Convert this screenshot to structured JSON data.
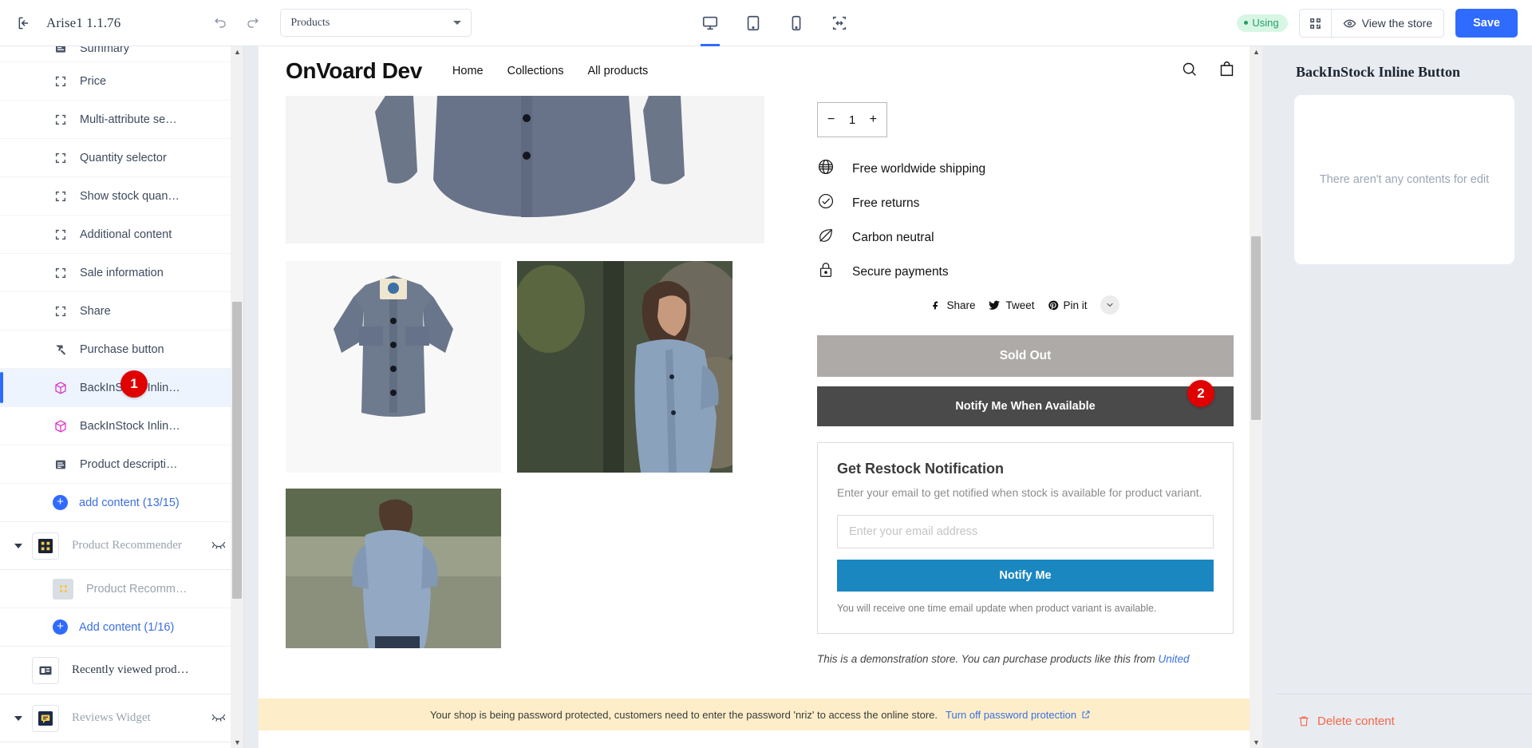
{
  "topbar": {
    "back_icon": "exit-icon",
    "title": "Arise1 1.1.76",
    "undo_icon": "undo-icon",
    "redo_icon": "redo-icon",
    "page_select": {
      "value": "Products",
      "caret_icon": "chevron-down-icon"
    },
    "devices": [
      {
        "name": "desktop",
        "icon": "desktop-icon",
        "active": true
      },
      {
        "name": "tablet",
        "icon": "tablet-icon",
        "active": false
      },
      {
        "name": "mobile",
        "icon": "mobile-icon",
        "active": false
      },
      {
        "name": "fullwidth",
        "icon": "fullwidth-icon",
        "active": false
      }
    ],
    "status_badge": "Using",
    "qr_icon": "qr-code-icon",
    "view_store_label": "View the store",
    "view_store_icon": "eye-icon",
    "save_label": "Save"
  },
  "sidebar": {
    "items": [
      {
        "label": "Summary",
        "icon": "text-block-icon",
        "type": "doc"
      },
      {
        "label": "Price",
        "icon": "placeholder-icon",
        "type": "bracket"
      },
      {
        "label": "Multi-attribute se…",
        "icon": "placeholder-icon",
        "type": "bracket"
      },
      {
        "label": "Quantity selector",
        "icon": "placeholder-icon",
        "type": "bracket"
      },
      {
        "label": "Show stock quan…",
        "icon": "placeholder-icon",
        "type": "bracket"
      },
      {
        "label": "Additional content",
        "icon": "placeholder-icon",
        "type": "bracket"
      },
      {
        "label": "Sale information",
        "icon": "placeholder-icon",
        "type": "bracket"
      },
      {
        "label": "Share",
        "icon": "placeholder-icon",
        "type": "bracket"
      },
      {
        "label": "Purchase button",
        "icon": "cursor-click-icon",
        "type": "cursor"
      },
      {
        "label": "BackInStock Inlin…",
        "icon": "package-icon",
        "type": "package",
        "selected": true,
        "badge": "1"
      },
      {
        "label": "BackInStock Inlin…",
        "icon": "package-icon",
        "type": "package"
      },
      {
        "label": "Product descripti…",
        "icon": "text-block-icon",
        "type": "doc"
      }
    ],
    "add_content_1": "add content (13/15)",
    "group_recommender": {
      "label": "Product Recommender",
      "icon": "grid-yellow-icon",
      "eye_icon": "eye-off-icon"
    },
    "sub_recommender": {
      "label": "Product Recomm…",
      "icon": "grid-yellow-icon"
    },
    "add_content_2": "Add content (1/16)",
    "group_recently_viewed": {
      "label": "Recently viewed prod…",
      "icon": "card-list-icon"
    },
    "group_reviews": {
      "label": "Reviews Widget",
      "icon": "review-icon",
      "eye_icon": "eye-off-icon"
    }
  },
  "store": {
    "logo": "OnVoard Dev",
    "nav": [
      "Home",
      "Collections",
      "All products"
    ],
    "search_icon": "search-icon",
    "cart_icon": "shopping-bag-icon",
    "quantity": {
      "minus": "−",
      "value": "1",
      "plus": "+"
    },
    "features": [
      {
        "label": "Free worldwide shipping",
        "icon": "globe-icon"
      },
      {
        "label": "Free returns",
        "icon": "check-circle-icon"
      },
      {
        "label": "Carbon neutral",
        "icon": "leaf-icon"
      },
      {
        "label": "Secure payments",
        "icon": "lock-icon"
      }
    ],
    "share": [
      {
        "label": "Share",
        "icon": "facebook-icon"
      },
      {
        "label": "Tweet",
        "icon": "twitter-icon"
      },
      {
        "label": "Pin it",
        "icon": "pinterest-icon"
      }
    ],
    "share_more_icon": "chevron-down-icon",
    "sold_out_label": "Sold Out",
    "notify_available_label": "Notify Me When Available",
    "notify_badge": "2",
    "restock": {
      "title": "Get Restock Notification",
      "subtitle": "Enter your email to get notified when stock is available for product variant.",
      "email_placeholder": "Enter your email address",
      "email_value": "",
      "button_label": "Notify Me",
      "note": "You will receive one time email update when product variant is available."
    },
    "demo_note_prefix": "This is a demonstration store. You can purchase products like this from ",
    "demo_note_link": "United"
  },
  "password_bar": {
    "text": "Your shop is being password protected, customers need to enter the password 'nriz' to access the online store.",
    "link": "Turn off password protection",
    "link_icon": "external-link-icon"
  },
  "right_panel": {
    "title": "BackInStock Inline Button",
    "empty_message": "There aren't any contents for edit",
    "delete_label": "Delete content",
    "delete_icon": "trash-icon"
  },
  "colors": {
    "accent_blue": "#2f6bff",
    "badge_red": "#e00000",
    "notify_blue": "#1b87c1",
    "delete_orange": "#f4664a",
    "using_green": "#22a06b",
    "warning_bg": "#fdeec9"
  }
}
